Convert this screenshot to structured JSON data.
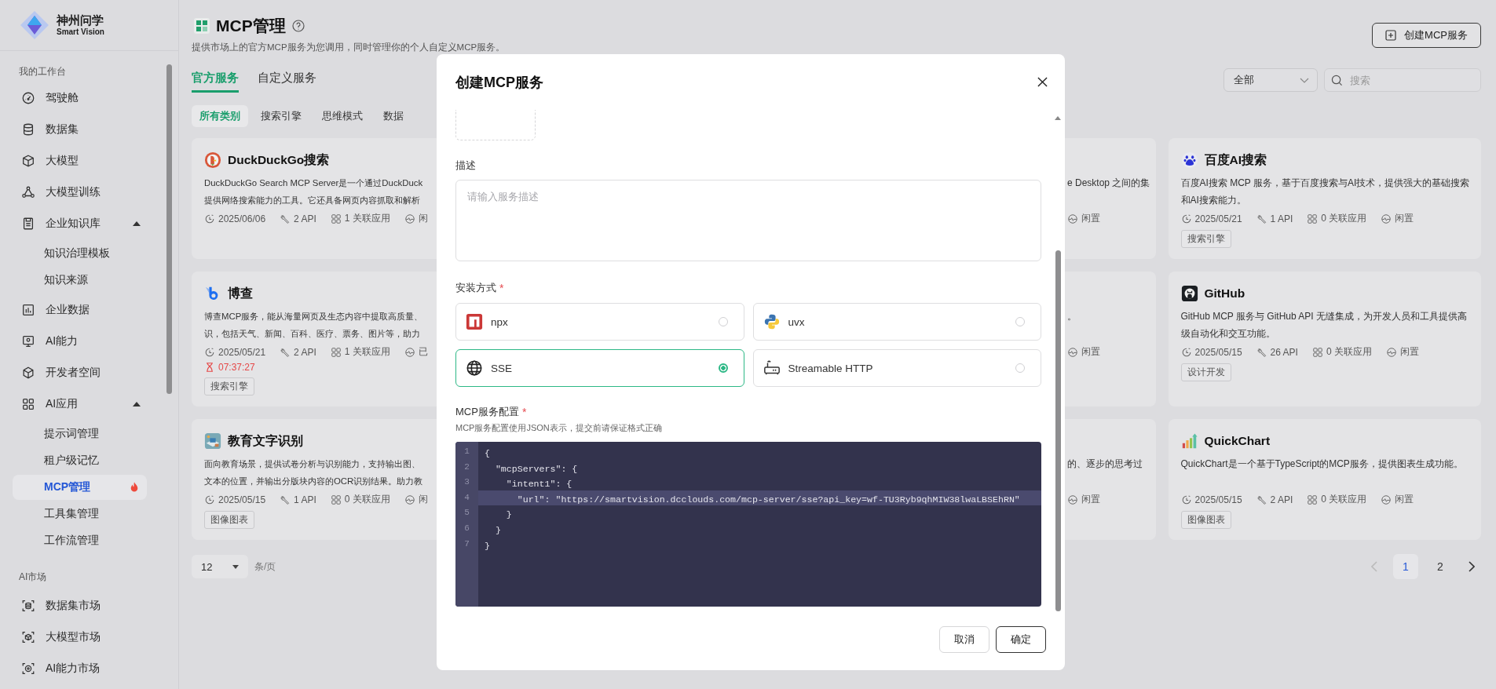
{
  "sidebar": {
    "logo": {
      "name": "神州问学",
      "subtitle": "Smart Vision"
    },
    "sections": [
      {
        "title": "我的工作台",
        "items": [
          {
            "label": "驾驶舱",
            "selected": false
          },
          {
            "label": "数据集",
            "selected": false
          },
          {
            "label": "大模型",
            "selected": false
          },
          {
            "label": "大模型训练",
            "selected": false
          },
          {
            "label": "企业知识库",
            "selected": false,
            "expanded": true,
            "children": [
              {
                "label": "知识治理模板",
                "selected": false,
                "hot": false
              },
              {
                "label": "知识来源",
                "selected": false,
                "hot": false
              }
            ]
          },
          {
            "label": "企业数据",
            "selected": false
          },
          {
            "label": "AI能力",
            "selected": false
          },
          {
            "label": "开发者空间",
            "selected": false
          },
          {
            "label": "AI应用",
            "selected": false,
            "expanded": true,
            "children": [
              {
                "label": "提示词管理",
                "selected": false,
                "hot": false
              },
              {
                "label": "租户级记忆",
                "selected": false,
                "hot": false
              },
              {
                "label": "MCP管理",
                "selected": true,
                "hot": true
              },
              {
                "label": "工具集管理",
                "selected": false,
                "hot": false
              },
              {
                "label": "工作流管理",
                "selected": false,
                "hot": false
              }
            ]
          }
        ]
      },
      {
        "title": "AI市场",
        "items": [
          {
            "label": "数据集市场",
            "selected": false
          },
          {
            "label": "大模型市场",
            "selected": false
          },
          {
            "label": "AI能力市场",
            "selected": false
          }
        ]
      }
    ]
  },
  "header": {
    "title": "MCP管理",
    "subtitle": "提供市场上的官方MCP服务为您调用，同时管理你的个人自定义MCP服务。",
    "create_button": "创建MCP服务"
  },
  "tabs": [
    {
      "label": "官方服务",
      "selected": true
    },
    {
      "label": "自定义服务",
      "selected": false
    }
  ],
  "filter": {
    "value": "全部"
  },
  "search": {
    "placeholder": "搜索"
  },
  "categories": [
    {
      "label": "所有类别",
      "selected": true
    },
    {
      "label": "搜索引擎",
      "selected": false
    },
    {
      "label": "思维模式",
      "selected": false
    },
    {
      "label": "数据",
      "selected": false
    }
  ],
  "card_rows": [
    {
      "cards": [
        {
          "kind": "card",
          "title": "DuckDuckGo搜索",
          "description": [
            "DuckDuckGo Search MCP Server是一个通过DuckDuck",
            "提供网络搜索能力的工具。它还具备网页内容抓取和解析"
          ],
          "date": "2025/06/06",
          "apis": "2 API",
          "apps": "1 关联应用",
          "status": "闲"
        },
        {
          "kind": "fragment",
          "description": [
            "e Desktop 之间的集"
          ],
          "status": "闲置"
        },
        {
          "kind": "card",
          "title": "百度AI搜索",
          "description": [
            "百度AI搜索 MCP 服务，基于百度搜索与AI技术，提供强大的基础搜索",
            "和AI搜索能力。"
          ],
          "date": "2025/05/21",
          "apis": "1 API",
          "apps": "0 关联应用",
          "status": "闲置",
          "tag": "搜索引擎"
        }
      ]
    },
    {
      "cards": [
        {
          "kind": "card",
          "title": "博查",
          "description": [
            "博查MCP服务，能从海量网页及生态内容中提取高质量、",
            "识，包括天气、新闻、百科、医疗、票务、图片等，助力"
          ],
          "date": "2025/05/21",
          "apis": "2 API",
          "apps": "1 关联应用",
          "status": "已",
          "timer": "07:37:27",
          "tag": "搜索引擎"
        },
        {
          "kind": "fragment",
          "description": [
            "。"
          ],
          "status": "闲置"
        },
        {
          "kind": "card",
          "title": "GitHub",
          "description": [
            "GitHub MCP 服务与 GitHub API 无缝集成，为开发人员和工具提供高",
            "级自动化和交互功能。"
          ],
          "date": "2025/05/15",
          "apis": "26 API",
          "apps": "0 关联应用",
          "status": "闲置",
          "tag": "设计开发"
        }
      ]
    },
    {
      "cards": [
        {
          "kind": "card",
          "title": "教育文字识别",
          "description": [
            "面向教育场景，提供试卷分析与识别能力，支持输出图、",
            "文本的位置，并输出分版块内容的OCR识别结果。助力教"
          ],
          "date": "2025/05/15",
          "apis": "1 API",
          "apps": "0 关联应用",
          "status": "闲",
          "tag": "图像图表"
        },
        {
          "kind": "fragment",
          "description": [
            "的、逐步的思考过"
          ],
          "status": "闲置"
        },
        {
          "kind": "card",
          "title": "QuickChart",
          "description": [
            "QuickChart是一个基于TypeScript的MCP服务，提供图表生成功能。"
          ],
          "date": "2025/05/15",
          "apis": "2 API",
          "apps": "0 关联应用",
          "status": "闲置",
          "tag": "图像图表"
        }
      ]
    }
  ],
  "pagination": {
    "page_size": "12",
    "page_size_unit": "条/页",
    "prev_disabled": true,
    "pages": [
      {
        "label": "1",
        "selected": true
      },
      {
        "label": "2",
        "selected": false
      }
    ]
  },
  "modal": {
    "title": "创建MCP服务",
    "description": {
      "label": "描述",
      "placeholder": "请输入服务描述"
    },
    "install": {
      "label": "安装方式",
      "required_mark": "*",
      "options": [
        {
          "label": "npx",
          "selected": false
        },
        {
          "label": "uvx",
          "selected": false
        },
        {
          "label": "SSE",
          "selected": true
        },
        {
          "label": "Streamable HTTP",
          "selected": false
        }
      ]
    },
    "config": {
      "label": "MCP服务配置",
      "required_mark": "*",
      "hint": "MCP服务配置使用JSON表示，提交前请保证格式正确",
      "lines": [
        {
          "number": "1",
          "text": "{",
          "current": false
        },
        {
          "number": "2",
          "text": "  \"mcpServers\": {",
          "current": false
        },
        {
          "number": "3",
          "text": "    \"intent1\": {",
          "current": false
        },
        {
          "number": "4",
          "text": "      \"url\": \"https://smartvision.dcclouds.com/mcp-server/sse?api_key=wf-TU3Ryb9qhMIW38lwaLBSEhRN\"",
          "current": true
        },
        {
          "number": "5",
          "text": "    }",
          "current": false
        },
        {
          "number": "6",
          "text": "  }",
          "current": false
        },
        {
          "number": "7",
          "text": "}",
          "current": false
        }
      ]
    },
    "buttons": [
      {
        "label": "取消",
        "kind": "secondary"
      },
      {
        "label": "确定",
        "kind": "primary"
      }
    ]
  }
}
